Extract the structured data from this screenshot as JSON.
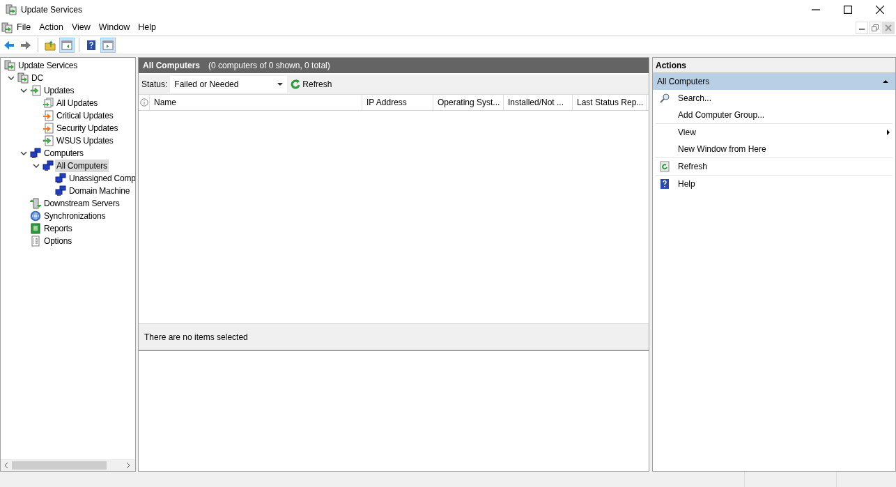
{
  "window": {
    "title": "Update Services"
  },
  "menu": [
    "File",
    "Action",
    "View",
    "Window",
    "Help"
  ],
  "toolbar": [
    {
      "kind": "back",
      "pressed": false
    },
    {
      "kind": "forward",
      "pressed": false
    },
    {
      "kind": "up",
      "pressed": false
    },
    {
      "kind": "tree-pane",
      "pressed": true
    },
    {
      "kind": "help",
      "pressed": false
    },
    {
      "kind": "action-pane",
      "pressed": true
    }
  ],
  "tree": [
    {
      "label": "Update Services",
      "kind": "server",
      "selected": false,
      "children": [
        {
          "label": "DC",
          "kind": "server",
          "selected": false,
          "expanded": true,
          "children": [
            {
              "label": "Updates",
              "kind": "updates",
              "selected": false,
              "expanded": true,
              "children": [
                {
                  "label": "All Updates",
                  "kind": "stack",
                  "selected": false
                },
                {
                  "label": "Critical Updates",
                  "kind": "orange",
                  "selected": false
                },
                {
                  "label": "Security Updates",
                  "kind": "orange",
                  "selected": false
                },
                {
                  "label": "WSUS Updates",
                  "kind": "updates",
                  "selected": false
                }
              ]
            },
            {
              "label": "Computers",
              "kind": "computers",
              "selected": false,
              "expanded": true,
              "children": [
                {
                  "label": "All Computers",
                  "kind": "computers",
                  "selected": true,
                  "expanded": true,
                  "children": [
                    {
                      "label": "Unassigned Comp",
                      "kind": "computers",
                      "selected": false
                    },
                    {
                      "label": "Domain Machine",
                      "kind": "computers",
                      "selected": false
                    }
                  ]
                }
              ]
            },
            {
              "label": "Downstream Servers",
              "kind": "downstream",
              "selected": false
            },
            {
              "label": "Synchronizations",
              "kind": "sync",
              "selected": false
            },
            {
              "label": "Reports",
              "kind": "reports",
              "selected": false
            },
            {
              "label": "Options",
              "kind": "options",
              "selected": false
            }
          ]
        }
      ]
    }
  ],
  "content": {
    "title": "All Computers",
    "summary": "(0 computers of 0 shown, 0 total)",
    "status_label": "Status:",
    "status_value": "Failed or Needed",
    "refresh_label": "Refresh",
    "columns": [
      "Name",
      "IP Address",
      "Operating Syst...",
      "Installed/Not ...",
      "Last Status Rep..."
    ],
    "detail": "There are no items selected"
  },
  "actions": {
    "title": "Actions",
    "section": "All Computers",
    "items": [
      {
        "label": "Search...",
        "kind": "search",
        "submenu": false,
        "divider_after": false
      },
      {
        "label": "Add Computer Group...",
        "kind": "plain",
        "submenu": false,
        "divider_after": true
      },
      {
        "label": "View",
        "kind": "plain",
        "submenu": true,
        "divider_after": false
      },
      {
        "label": "New Window from Here",
        "kind": "plain",
        "submenu": false,
        "divider_after": true
      },
      {
        "label": "Refresh",
        "kind": "refresh",
        "submenu": false,
        "divider_after": true
      },
      {
        "label": "Help",
        "kind": "help",
        "submenu": false,
        "divider_after": false
      }
    ]
  }
}
